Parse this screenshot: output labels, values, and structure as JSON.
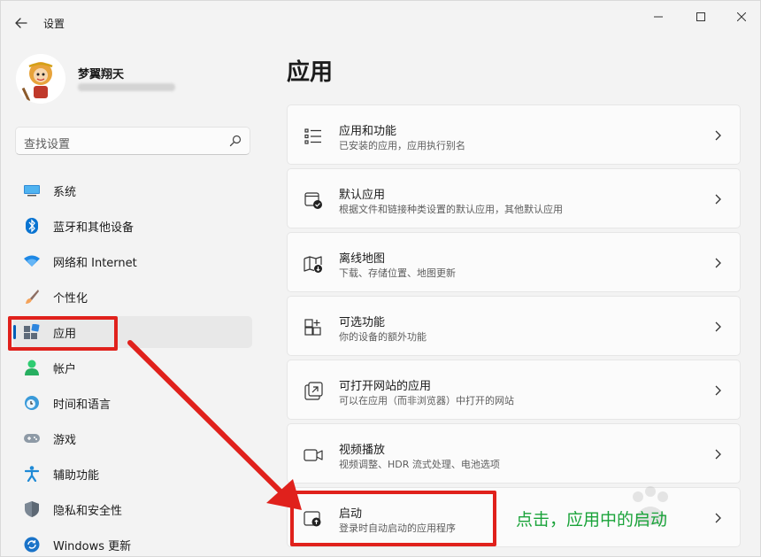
{
  "window": {
    "title": "设置"
  },
  "profile": {
    "name": "梦翼翔天"
  },
  "search": {
    "placeholder": "查找设置"
  },
  "sidebar": {
    "items": [
      {
        "label": "系统",
        "icon": "system-icon",
        "active": false
      },
      {
        "label": "蓝牙和其他设备",
        "icon": "bluetooth-icon",
        "active": false
      },
      {
        "label": "网络和 Internet",
        "icon": "wifi-icon",
        "active": false
      },
      {
        "label": "个性化",
        "icon": "brush-icon",
        "active": false
      },
      {
        "label": "应用",
        "icon": "apps-icon",
        "active": true
      },
      {
        "label": "帐户",
        "icon": "account-icon",
        "active": false
      },
      {
        "label": "时间和语言",
        "icon": "time-language-icon",
        "active": false
      },
      {
        "label": "游戏",
        "icon": "gamepad-icon",
        "active": false
      },
      {
        "label": "辅助功能",
        "icon": "accessibility-icon",
        "active": false
      },
      {
        "label": "隐私和安全性",
        "icon": "shield-icon",
        "active": false
      },
      {
        "label": "Windows 更新",
        "icon": "update-icon",
        "active": false
      }
    ]
  },
  "main": {
    "title": "应用",
    "cards": [
      {
        "title": "应用和功能",
        "subtitle": "已安装的应用，应用执行别名",
        "icon": "list-icon"
      },
      {
        "title": "默认应用",
        "subtitle": "根据文件和链接种类设置的默认应用，其他默认应用",
        "icon": "default-app-icon"
      },
      {
        "title": "离线地图",
        "subtitle": "下载、存储位置、地图更新",
        "icon": "map-icon"
      },
      {
        "title": "可选功能",
        "subtitle": "你的设备的额外功能",
        "icon": "add-grid-icon"
      },
      {
        "title": "可打开网站的应用",
        "subtitle": "可以在应用（而非浏览器）中打开的网站",
        "icon": "open-web-icon"
      },
      {
        "title": "视频播放",
        "subtitle": "视频调整、HDR 流式处理、电池选项",
        "icon": "video-icon"
      },
      {
        "title": "启动",
        "subtitle": "登录时自动启动的应用程序",
        "icon": "startup-icon"
      }
    ]
  },
  "annotation": {
    "text": "点击，应用中的启动",
    "color": "#1aa33a",
    "highlight_color": "#e0211c"
  },
  "colors": {
    "accent": "#005fb8",
    "background": "#f3f3f3"
  }
}
